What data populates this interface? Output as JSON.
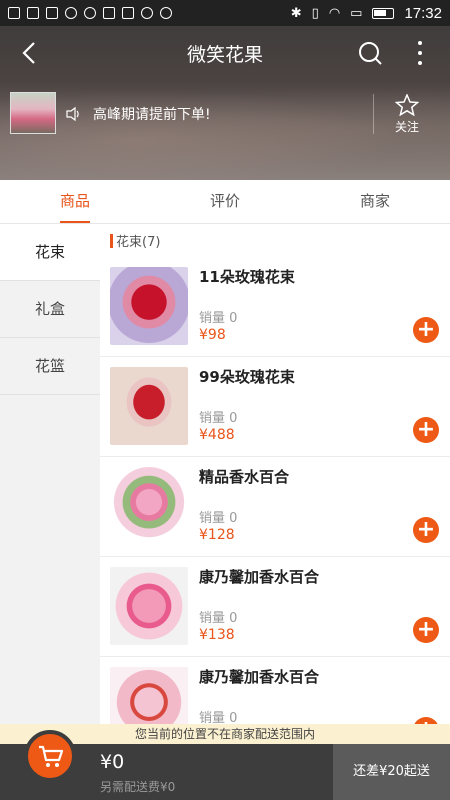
{
  "status_bar": {
    "time": "17:32"
  },
  "nav": {
    "title": "微笑花果"
  },
  "shop": {
    "notice": "高峰期请提前下单!",
    "follow_label": "关注"
  },
  "tabs": [
    {
      "label": "商品"
    },
    {
      "label": "评价"
    },
    {
      "label": "商家"
    }
  ],
  "categories": [
    {
      "label": "花束"
    },
    {
      "label": "礼盒"
    },
    {
      "label": "花篮"
    }
  ],
  "section": {
    "title": "花束(7)"
  },
  "products": [
    {
      "name": "11朵玫瑰花束",
      "sales": "销量 0",
      "price": "¥98"
    },
    {
      "name": "99朵玫瑰花束",
      "sales": "销量 0",
      "price": "¥488"
    },
    {
      "name": "精品香水百合",
      "sales": "销量 0",
      "price": "¥128"
    },
    {
      "name": "康乃馨加香水百合",
      "sales": "销量 0",
      "price": "¥138"
    },
    {
      "name": "康乃馨加香水百合",
      "sales": "销量 0",
      "price": ""
    }
  ],
  "delivery_notice": "您当前的位置不在商家配送范围内",
  "cart": {
    "total": "¥0",
    "delivery_fee": "另需配送费¥0",
    "checkout_label": "还差¥20起送"
  },
  "colors": {
    "accent": "#ee5a15",
    "tab_active": "#e8541a",
    "cart_bar": "#3d3d3d"
  }
}
